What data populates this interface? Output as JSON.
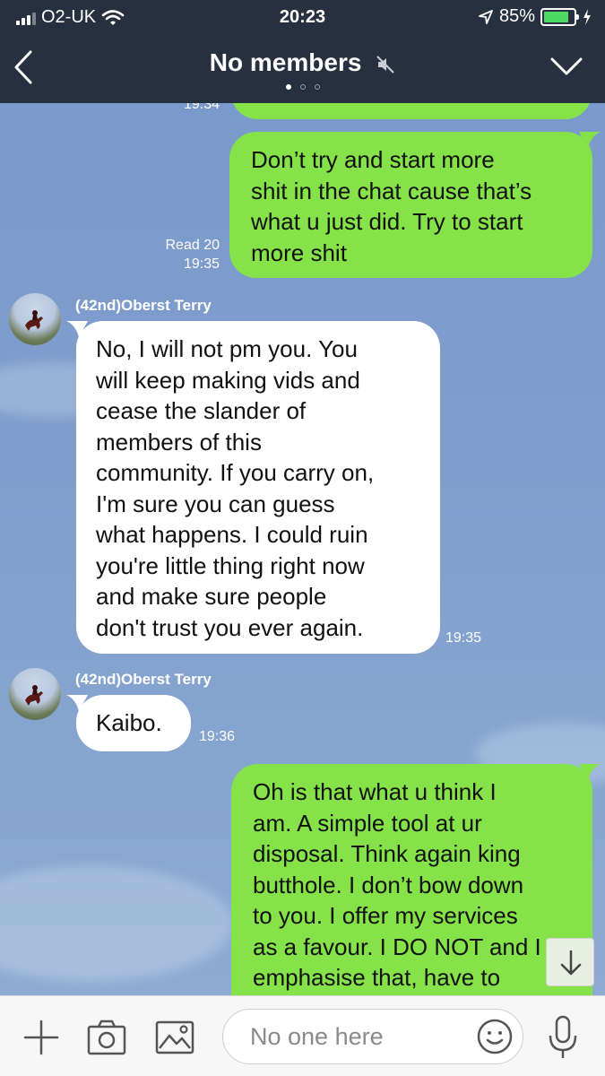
{
  "status_bar": {
    "carrier": "O2-UK",
    "time": "20:23",
    "battery": "85%",
    "battery_level": 0.85
  },
  "header": {
    "title": "No members",
    "page_count": 3,
    "active_page": 1
  },
  "messages": [
    {
      "id": "m0",
      "direction": "outgoing",
      "text": "",
      "time": "19:34"
    },
    {
      "id": "m1",
      "direction": "outgoing",
      "lines": [
        "Don’t try and start more",
        "shit in the chat cause that’s",
        "what u just did. Try to start",
        "more shit"
      ],
      "read": "Read 20",
      "time": "19:35"
    },
    {
      "id": "m2",
      "direction": "incoming",
      "sender": "(42nd)Oberst Terry",
      "lines": [
        "No, I will not pm you. You",
        "will keep making vids and",
        "cease the slander of",
        "members of this",
        "community. If you carry on,",
        "I'm sure you can guess",
        "what happens. I could ruin",
        "you're little thing right now",
        "and make sure people",
        "don't trust you ever again."
      ],
      "time": "19:35"
    },
    {
      "id": "m3",
      "direction": "incoming",
      "sender": "(42nd)Oberst Terry",
      "lines": [
        "Kaibo."
      ],
      "time": "19:36"
    },
    {
      "id": "m4",
      "direction": "outgoing",
      "lines": [
        "Oh is that what u think I",
        "am. A simple tool at ur",
        "disposal. Think again king",
        "butthole. I don’t bow down",
        "to you. I offer my services",
        "as a favour. I DO NOT and I",
        "emphasise that, have to"
      ]
    }
  ],
  "input_bar": {
    "placeholder": "No one here"
  },
  "icons": {
    "back": "chevron-left-icon",
    "mute": "speaker-muted-icon",
    "dropdown": "chevron-down-icon",
    "add": "plus-icon",
    "camera": "camera-icon",
    "gallery": "image-icon",
    "emoji": "smiley-icon",
    "mic": "microphone-icon",
    "scroll": "arrow-down-icon"
  },
  "colors": {
    "header_bg": "#27303f",
    "outgoing_bubble": "#85e249",
    "incoming_bubble": "#ffffff",
    "battery_fill": "#4cd964"
  }
}
